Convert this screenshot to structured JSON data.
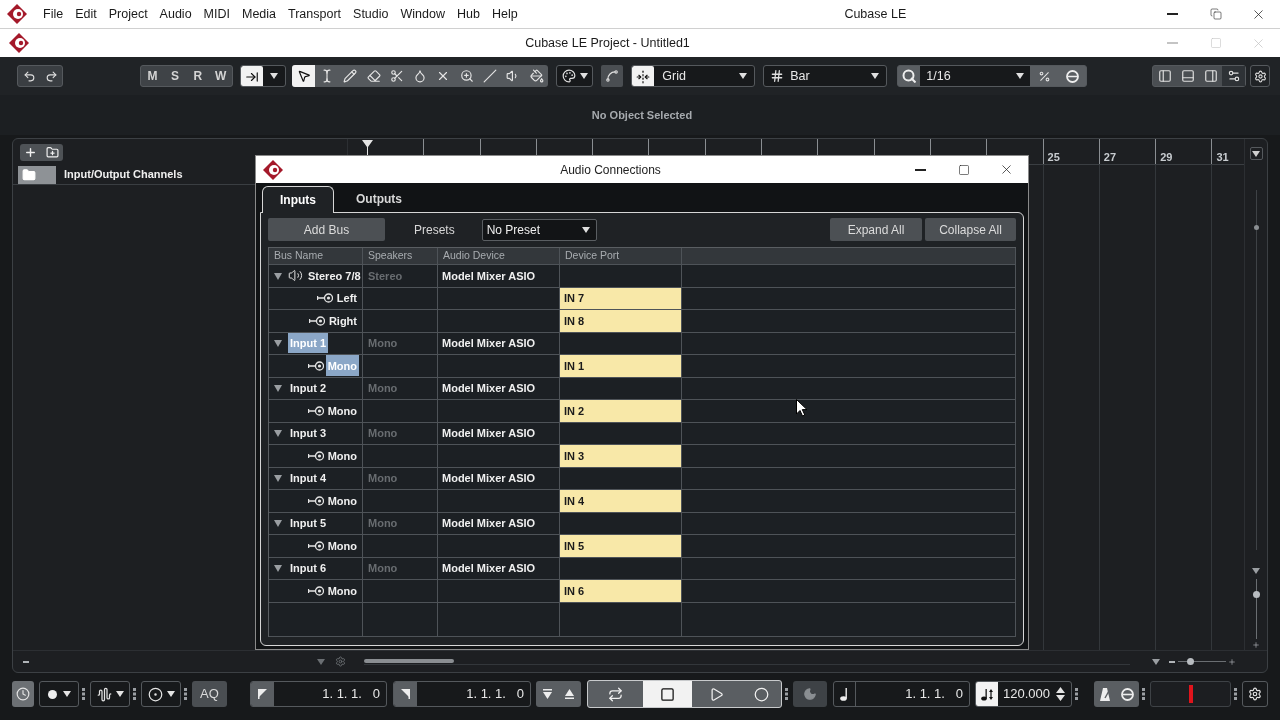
{
  "menubar": {
    "items": [
      "File",
      "Edit",
      "Project",
      "Audio",
      "MIDI",
      "Media",
      "Transport",
      "Studio",
      "Window",
      "Hub",
      "Help"
    ],
    "title": "Cubase LE"
  },
  "project_window": {
    "title": "Cubase LE Project - Untitled1"
  },
  "toolbar": {
    "mode_buttons": [
      "M",
      "S",
      "R",
      "W"
    ],
    "toggles": [
      {
        "kind": "drag",
        "on": true
      },
      {
        "kind": "autoscroll",
        "on": false
      },
      {
        "kind": "snap",
        "on": true
      }
    ],
    "tools": [
      {
        "kind": "pointer",
        "selected": true
      },
      {
        "kind": "range",
        "selected": false
      },
      {
        "kind": "pencil",
        "selected": false
      },
      {
        "kind": "eraser",
        "selected": false
      },
      {
        "kind": "scissors",
        "selected": false
      },
      {
        "kind": "glue",
        "selected": false
      },
      {
        "kind": "mute",
        "selected": false
      },
      {
        "kind": "zoom",
        "selected": false
      },
      {
        "kind": "line",
        "selected": false
      },
      {
        "kind": "play",
        "selected": false
      },
      {
        "kind": "warp",
        "selected": false
      }
    ],
    "snap_type": "Grid",
    "grid_type": "Bar",
    "quantize": "1/16"
  },
  "info_line": {
    "text": "No Object Selected"
  },
  "tracklist": {
    "tracks": [
      {
        "name": "Input/Output Channels",
        "kind": "folder"
      }
    ]
  },
  "ruler": {
    "labels": [
      "25",
      "27",
      "29",
      "31"
    ]
  },
  "arrange": {
    "horizontal_zoom": {
      "level": 0.27
    },
    "vertical_zoom": {
      "level": 0.75
    }
  },
  "dialog": {
    "title": "Audio Connections",
    "tabs": [
      {
        "label": "Inputs",
        "selected": true
      },
      {
        "label": "Outputs",
        "selected": false
      }
    ],
    "buttons": {
      "add_bus": "Add Bus",
      "expand_all": "Expand All",
      "collapse_all": "Collapse All"
    },
    "presets": {
      "label": "Presets",
      "value": "No Preset"
    },
    "table": {
      "columns": [
        "Bus Name",
        "Speakers",
        "Audio Device",
        "Device Port"
      ],
      "rows": [
        {
          "name": "Stereo 7/8",
          "kind": "stereo",
          "speakers": "Stereo",
          "device": "Model Mixer ASIO",
          "expanded": true,
          "selected": false,
          "children": [
            {
              "name": "Left",
              "port": "IN 7",
              "selected": false
            },
            {
              "name": "Right",
              "port": "IN 8",
              "selected": false
            }
          ]
        },
        {
          "name": "Input 1",
          "kind": "mono",
          "speakers": "Mono",
          "device": "Model Mixer ASIO",
          "expanded": true,
          "selected": true,
          "children": [
            {
              "name": "Mono",
              "port": "IN 1",
              "selected": true
            }
          ]
        },
        {
          "name": "Input 2",
          "kind": "mono",
          "speakers": "Mono",
          "device": "Model Mixer ASIO",
          "expanded": true,
          "selected": false,
          "children": [
            {
              "name": "Mono",
              "port": "IN 2",
              "selected": false
            }
          ]
        },
        {
          "name": "Input 3",
          "kind": "mono",
          "speakers": "Mono",
          "device": "Model Mixer ASIO",
          "expanded": true,
          "selected": false,
          "children": [
            {
              "name": "Mono",
              "port": "IN 3",
              "selected": false
            }
          ]
        },
        {
          "name": "Input 4",
          "kind": "mono",
          "speakers": "Mono",
          "device": "Model Mixer ASIO",
          "expanded": true,
          "selected": false,
          "children": [
            {
              "name": "Mono",
              "port": "IN 4",
              "selected": false
            }
          ]
        },
        {
          "name": "Input 5",
          "kind": "mono",
          "speakers": "Mono",
          "device": "Model Mixer ASIO",
          "expanded": true,
          "selected": false,
          "children": [
            {
              "name": "Mono",
              "port": "IN 5",
              "selected": false
            }
          ]
        },
        {
          "name": "Input 6",
          "kind": "mono",
          "speakers": "Mono",
          "device": "Model Mixer ASIO",
          "expanded": true,
          "selected": false,
          "children": [
            {
              "name": "Mono",
              "port": "IN 6",
              "selected": false
            }
          ]
        }
      ]
    }
  },
  "transport": {
    "aq": "AQ",
    "left_locator": "1. 1. 1.   0",
    "right_locator": "1. 1. 1.   0",
    "buttons": [
      {
        "kind": "cycle",
        "active": false
      },
      {
        "kind": "stop",
        "active": true
      },
      {
        "kind": "play",
        "active": false
      },
      {
        "kind": "record",
        "active": false
      }
    ],
    "position": "1. 1. 1.   0",
    "tempo": {
      "value": "120.000",
      "track_on": true
    }
  }
}
